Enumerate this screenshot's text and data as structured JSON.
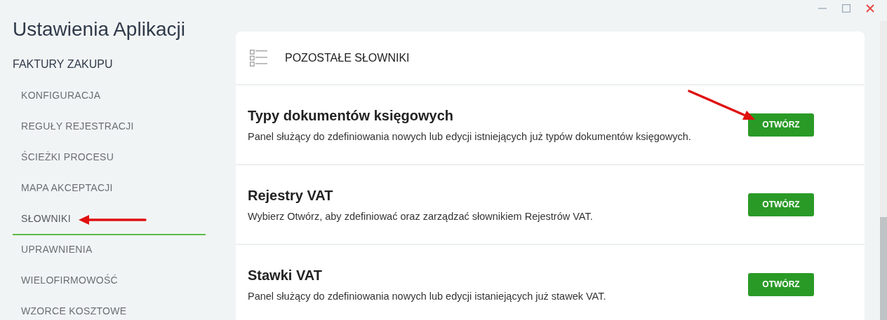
{
  "sidebar": {
    "title": "Ustawienia Aplikacji",
    "section": "FAKTURY ZAKUPU",
    "items": [
      {
        "label": "KONFIGURACJA",
        "selected": false
      },
      {
        "label": "REGUŁY REJESTRACJI",
        "selected": false
      },
      {
        "label": "ŚCIEŻKI PROCESU",
        "selected": false
      },
      {
        "label": "MAPA AKCEPTACJI",
        "selected": false
      },
      {
        "label": "SŁOWNIKI",
        "selected": true
      },
      {
        "label": "UPRAWNIENIA",
        "selected": false
      },
      {
        "label": "WIELOFIRMOWOŚĆ",
        "selected": false
      },
      {
        "label": "WZORCE KOSZTOWE",
        "selected": false
      }
    ]
  },
  "panel": {
    "title": "POZOSTAŁE SŁOWNIKI",
    "rows": [
      {
        "title": "Typy dokumentów księgowych",
        "description": "Panel służący do zdefiniowania nowych lub edycji istniejących już typów dokumentów księgowych.",
        "button": "OTWÓRZ"
      },
      {
        "title": "Rejestry VAT",
        "description": "Wybierz Otwórz, aby zdefiniować oraz zarządzać słownikiem Rejestrów VAT.",
        "button": "OTWÓRZ"
      },
      {
        "title": "Stawki VAT",
        "description": "Panel służący do zdefiniowania nowych lub edycji istaniejących już stawek VAT.",
        "button": "OTWÓRZ"
      }
    ]
  }
}
